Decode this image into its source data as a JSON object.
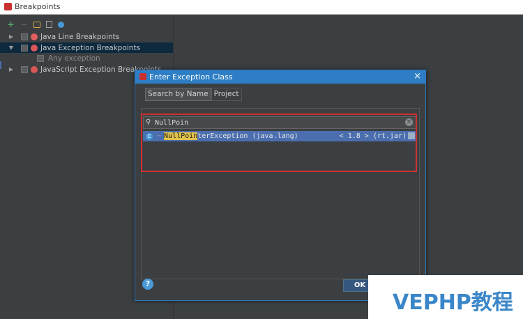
{
  "window": {
    "title": "Breakpoints"
  },
  "toolbar": {
    "add": "+",
    "remove": "−"
  },
  "tree": {
    "items": [
      {
        "label": "Java Line Breakpoints",
        "expanded": false
      },
      {
        "label": "Java Exception Breakpoints",
        "expanded": true,
        "selected": true
      },
      {
        "label": "Any exception",
        "child": true
      },
      {
        "label": "JavaScript Exception Breakpoints",
        "expanded": false
      }
    ]
  },
  "dialog": {
    "title": "Enter Exception Class",
    "close": "×",
    "tabs": [
      "Search by Name",
      "Project"
    ],
    "search_value": "NullPoin",
    "result": {
      "match": "NullPoin",
      "rest": "terException (java.lang)",
      "version": "< 1.8 > (rt.jar)"
    },
    "help": "?",
    "ok": "OK"
  },
  "watermark": {
    "text": "VEPHP教程"
  }
}
